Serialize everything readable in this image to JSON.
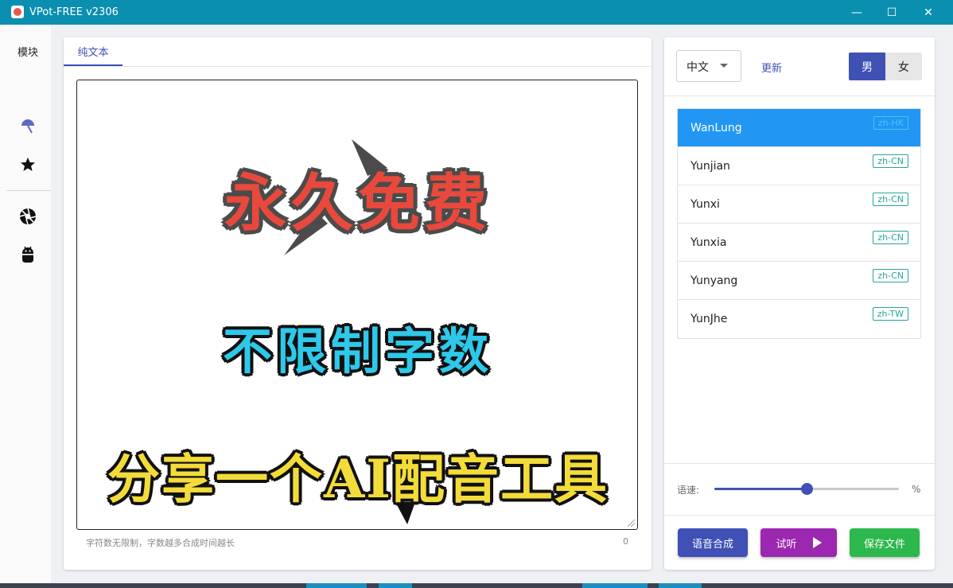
{
  "window": {
    "title": "VPot-FREE v2306",
    "controls": {
      "minimize": "—",
      "maximize": "☐",
      "close": "✕"
    }
  },
  "nav": {
    "title": "模块",
    "icons": [
      "umbrella-icon",
      "star-icon",
      "aperture-icon",
      "android-icon"
    ]
  },
  "editor": {
    "tab_label": "纯文本",
    "content_lines": [
      "永久免费",
      "不限制字数",
      "分享一个AI配音工具"
    ],
    "hint": "字符数无限制，字数越多合成时间越长",
    "char_count": "0"
  },
  "voice_panel": {
    "language": "中文",
    "update_label": "更新",
    "gender_male": "男",
    "gender_female": "女",
    "selected_gender": "男",
    "voices": [
      {
        "name": "WanLung",
        "tag": "zh-HK",
        "selected": true
      },
      {
        "name": "Yunjian",
        "tag": "zh-CN",
        "selected": false
      },
      {
        "name": "Yunxi",
        "tag": "zh-CN",
        "selected": false
      },
      {
        "name": "Yunxia",
        "tag": "zh-CN",
        "selected": false
      },
      {
        "name": "Yunyang",
        "tag": "zh-CN",
        "selected": false
      },
      {
        "name": "YunJhe",
        "tag": "zh-TW",
        "selected": false
      }
    ],
    "speed_label": "语速:",
    "speed_value": 0.5,
    "speed_unit": "%",
    "buttons": {
      "synthesize": "语音合成",
      "preview": "试听",
      "save": "保存文件"
    }
  },
  "colors": {
    "titlebar": "#0b8fb0",
    "primary": "#3f51b5",
    "selected_voice": "#2196f3",
    "preview_button": "#9c27b0",
    "save_button": "#2db84d",
    "tag": "#26a69a"
  }
}
